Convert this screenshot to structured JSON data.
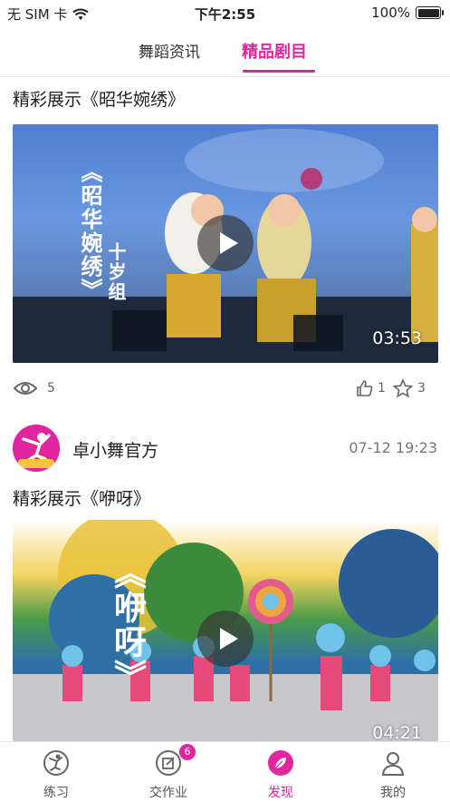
{
  "status_bar": {
    "carrier": "无 SIM 卡",
    "time": "下午2:55",
    "battery": "100%",
    "battery_level": 1.0
  },
  "tabs": [
    {
      "label": "舞蹈资讯",
      "active": false
    },
    {
      "label": "精品剧目",
      "active": true
    }
  ],
  "posts": [
    {
      "title": "精彩展示《昭华婉绣》",
      "video": {
        "duration": "03:53",
        "overlay_text": "《昭华婉绣》",
        "overlay_sub": "十岁组"
      },
      "views": "5",
      "likes": "1",
      "favorites": "3"
    },
    {
      "author": "卓小舞官方",
      "time": "07-12 19:23",
      "title": "精彩展示《咿呀》",
      "video": {
        "duration": "04:21",
        "overlay_text": "《咿呀》"
      }
    }
  ],
  "bottom_nav": [
    {
      "label": "练习",
      "icon": "dancer-icon",
      "active": false
    },
    {
      "label": "交作业",
      "icon": "edit-icon",
      "active": false,
      "badge": "6"
    },
    {
      "label": "发现",
      "icon": "leaf-icon",
      "active": true
    },
    {
      "label": "我的",
      "icon": "person-icon",
      "active": false
    }
  ],
  "colors": {
    "accent": "#e0259e"
  }
}
